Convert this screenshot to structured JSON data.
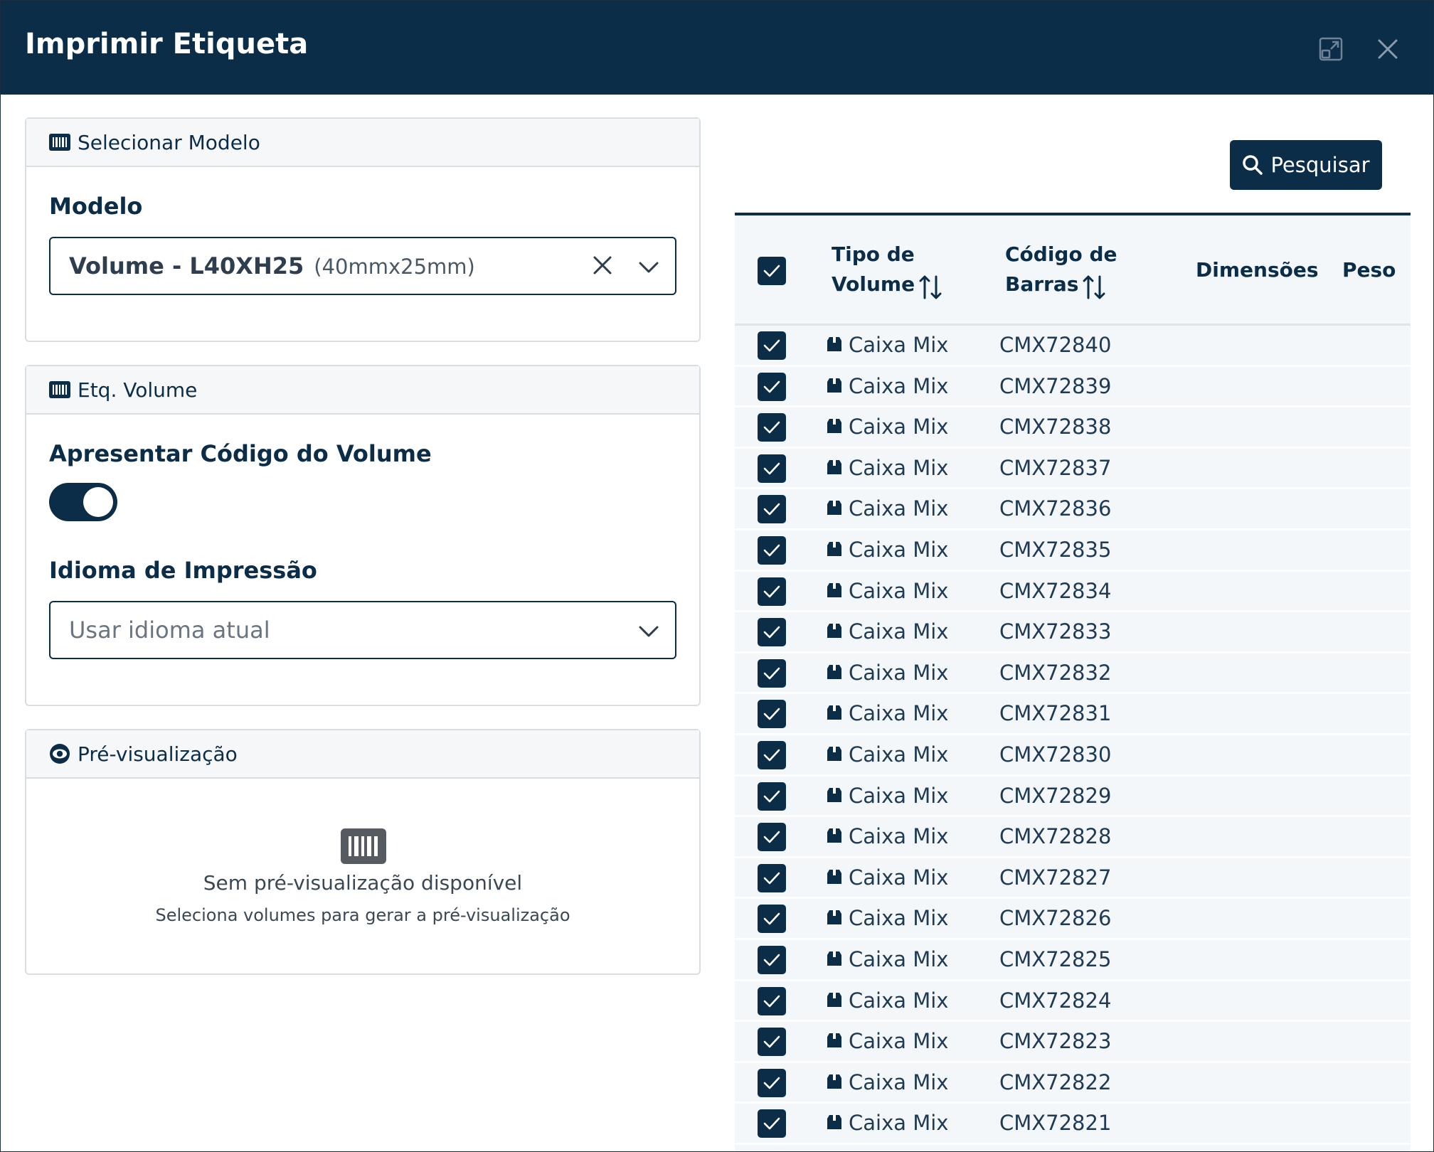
{
  "header": {
    "title": "Imprimir Etiqueta"
  },
  "model_panel": {
    "title": "Selecionar Modelo",
    "field_label": "Modelo",
    "selected_value": "Volume - L40XH25",
    "selected_detail": "(40mmx25mm)"
  },
  "volume_panel": {
    "title": "Etq. Volume",
    "toggle_label": "Apresentar Código do Volume",
    "toggle_on": true,
    "language_label": "Idioma de Impressão",
    "language_placeholder": "Usar idioma atual"
  },
  "preview_panel": {
    "title": "Pré-visualização",
    "empty_title": "Sem pré-visualização disponível",
    "empty_subtitle": "Seleciona volumes para gerar a pré-visualização"
  },
  "search_button": {
    "label": "Pesquisar"
  },
  "table": {
    "columns": {
      "tipo": [
        "Tipo de",
        "Volume"
      ],
      "codigo": [
        "Código de",
        "Barras"
      ],
      "dimensoes": "Dimensões",
      "peso": "Peso"
    },
    "rows": [
      {
        "tipo": "Caixa Mix",
        "codigo": "CMX72840"
      },
      {
        "tipo": "Caixa Mix",
        "codigo": "CMX72839"
      },
      {
        "tipo": "Caixa Mix",
        "codigo": "CMX72838"
      },
      {
        "tipo": "Caixa Mix",
        "codigo": "CMX72837"
      },
      {
        "tipo": "Caixa Mix",
        "codigo": "CMX72836"
      },
      {
        "tipo": "Caixa Mix",
        "codigo": "CMX72835"
      },
      {
        "tipo": "Caixa Mix",
        "codigo": "CMX72834"
      },
      {
        "tipo": "Caixa Mix",
        "codigo": "CMX72833"
      },
      {
        "tipo": "Caixa Mix",
        "codigo": "CMX72832"
      },
      {
        "tipo": "Caixa Mix",
        "codigo": "CMX72831"
      },
      {
        "tipo": "Caixa Mix",
        "codigo": "CMX72830"
      },
      {
        "tipo": "Caixa Mix",
        "codigo": "CMX72829"
      },
      {
        "tipo": "Caixa Mix",
        "codigo": "CMX72828"
      },
      {
        "tipo": "Caixa Mix",
        "codigo": "CMX72827"
      },
      {
        "tipo": "Caixa Mix",
        "codigo": "CMX72826"
      },
      {
        "tipo": "Caixa Mix",
        "codigo": "CMX72825"
      },
      {
        "tipo": "Caixa Mix",
        "codigo": "CMX72824"
      },
      {
        "tipo": "Caixa Mix",
        "codigo": "CMX72823"
      },
      {
        "tipo": "Caixa Mix",
        "codigo": "CMX72822"
      },
      {
        "tipo": "Caixa Mix",
        "codigo": "CMX72821"
      }
    ]
  },
  "colors": {
    "primary": "#0b2d48",
    "panel_header": "#f6f7f9",
    "table_bg": "#f4f7fa"
  },
  "icons": {
    "barcode": "barcode-icon",
    "eye": "eye-icon",
    "search": "search-icon",
    "box": "box-icon",
    "sort": "sort-icon",
    "expand": "expand-icon",
    "close": "close-icon"
  }
}
